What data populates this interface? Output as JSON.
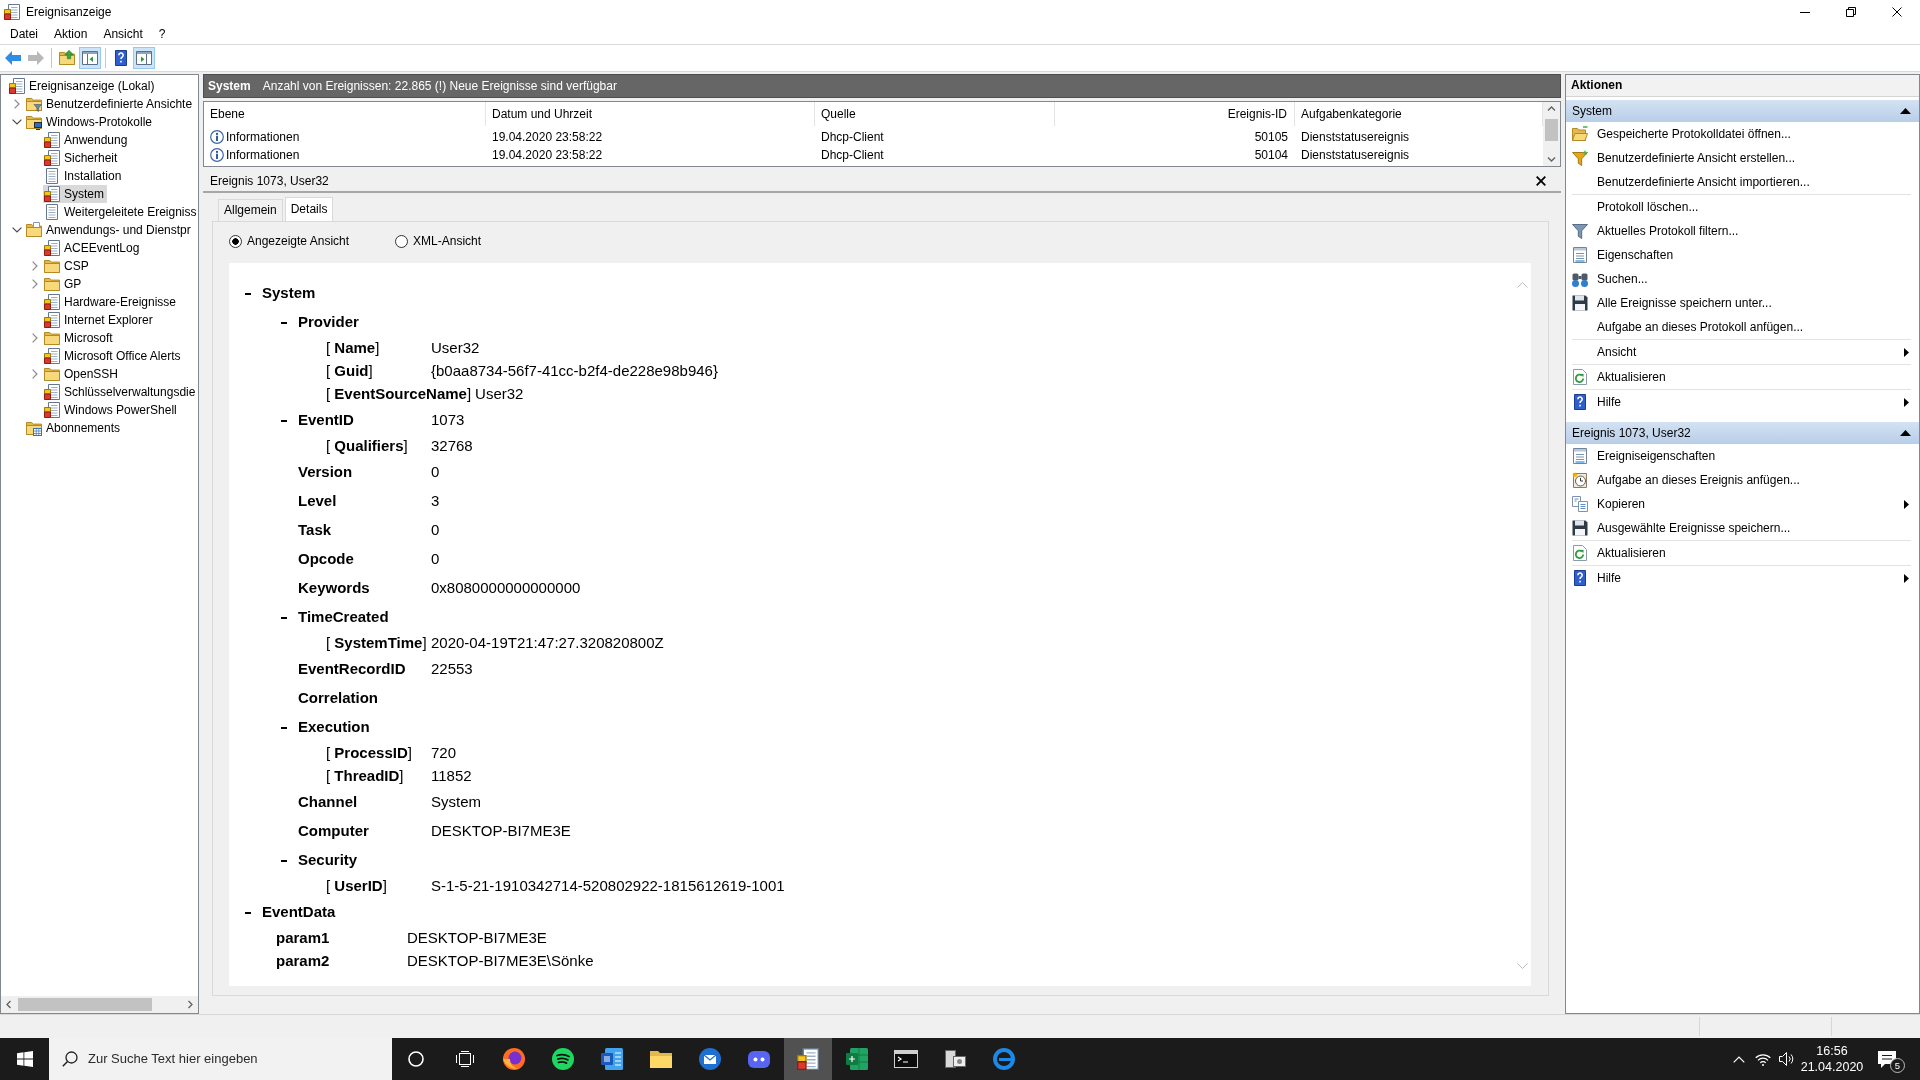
{
  "window": {
    "title": "Ereignisanzeige"
  },
  "menu": [
    "Datei",
    "Aktion",
    "Ansicht",
    "?"
  ],
  "toolbar": [
    [
      {
        "kind": "back",
        "pressed": false,
        "disabled": false
      },
      {
        "kind": "forward",
        "pressed": false,
        "disabled": true
      }
    ],
    [
      {
        "kind": "up",
        "pressed": false,
        "disabled": false
      },
      {
        "kind": "tree",
        "pressed": true,
        "disabled": false
      }
    ],
    [
      {
        "kind": "help",
        "pressed": false,
        "disabled": false
      },
      {
        "kind": "actions",
        "pressed": true,
        "disabled": false
      }
    ]
  ],
  "tree": [
    {
      "kind": "root",
      "label": "Ereignisanzeige (Lokal)",
      "selected": false,
      "children": [
        {
          "kind": "customviews",
          "label": "Benutzerdefinierte Ansichte",
          "selected": false,
          "expanded": false
        },
        {
          "kind": "windowslogs",
          "label": "Windows-Protokolle",
          "selected": false,
          "expanded": true,
          "children": [
            {
              "kind": "log",
              "label": "Anwendung",
              "selected": false
            },
            {
              "kind": "log",
              "label": "Sicherheit",
              "selected": false
            },
            {
              "kind": "plainlog",
              "label": "Installation",
              "selected": false
            },
            {
              "kind": "log",
              "label": "System",
              "selected": true
            },
            {
              "kind": "plainlog",
              "label": "Weitergeleitete Ereigniss",
              "selected": false
            }
          ]
        },
        {
          "kind": "appfolder",
          "label": "Anwendungs- und Dienstpr",
          "selected": false,
          "expanded": true,
          "children": [
            {
              "kind": "log",
              "label": "ACEEventLog",
              "selected": false
            },
            {
              "kind": "folder",
              "label": "CSP",
              "selected": false,
              "expanded": false
            },
            {
              "kind": "folder",
              "label": "GP",
              "selected": false,
              "expanded": false
            },
            {
              "kind": "log",
              "label": "Hardware-Ereignisse",
              "selected": false
            },
            {
              "kind": "log",
              "label": "Internet Explorer",
              "selected": false
            },
            {
              "kind": "folder",
              "label": "Microsoft",
              "selected": false,
              "expanded": false
            },
            {
              "kind": "log",
              "label": "Microsoft Office Alerts",
              "selected": false
            },
            {
              "kind": "folder",
              "label": "OpenSSH",
              "selected": false,
              "expanded": false
            },
            {
              "kind": "log",
              "label": "Schlüsselverwaltungsdie",
              "selected": false
            },
            {
              "kind": "log",
              "label": "Windows PowerShell",
              "selected": false
            }
          ]
        },
        {
          "kind": "subscriptions",
          "label": "Abonnements",
          "selected": false
        }
      ]
    }
  ],
  "log": {
    "title": "System",
    "summary": "Anzahl von Ereignissen: 22.865 (!) Neue Ereignisse sind verfügbar",
    "columns": [
      "Ebene",
      "Datum und Uhrzeit",
      "Quelle",
      "Ereignis-ID",
      "Aufgabenkategorie"
    ],
    "rows": [
      {
        "kind": "info",
        "selected": false,
        "cells": [
          "Informationen",
          "19.04.2020 23:58:22",
          "Dhcp-Client",
          "50105",
          "Dienststatusereignis"
        ]
      },
      {
        "kind": "info",
        "selected": false,
        "cells": [
          "Informationen",
          "19.04.2020 23:58:22",
          "Dhcp-Client",
          "50104",
          "Dienststatusereignis"
        ]
      }
    ]
  },
  "event": {
    "title": "Ereignis 1073, User32",
    "tabs": [
      {
        "label": "Allgemein",
        "selected": false
      },
      {
        "label": "Details",
        "selected": true
      }
    ],
    "views": [
      {
        "label": "Angezeigte Ansicht",
        "selected": true
      },
      {
        "label": "XML-Ansicht",
        "selected": false
      }
    ],
    "details": [
      {
        "kind": "section",
        "label": "System",
        "expanded": true,
        "children": [
          {
            "kind": "section",
            "label": "Provider",
            "expanded": true,
            "children": [
              {
                "kind": "attribute",
                "label": "[ **Name**]",
                "value": "User32"
              },
              {
                "kind": "attribute",
                "label": "[ **Guid**]",
                "value": "{b0aa8734-56f7-41cc-b2f4-de228e98b946}"
              },
              {
                "kind": "attribute",
                "label": "[ **EventSourceName**]",
                "value": "User32"
              }
            ]
          },
          {
            "kind": "section",
            "label": "EventID",
            "value": "1073",
            "expanded": true,
            "children": [
              {
                "kind": "attribute",
                "label": "[ **Qualifiers**]",
                "value": "32768"
              }
            ]
          },
          {
            "kind": "field",
            "label": "Version",
            "value": "0"
          },
          {
            "kind": "field",
            "label": "Level",
            "value": "3"
          },
          {
            "kind": "field",
            "label": "Task",
            "value": "0"
          },
          {
            "kind": "field",
            "label": "Opcode",
            "value": "0"
          },
          {
            "kind": "field",
            "label": "Keywords",
            "value": "0x8080000000000000"
          },
          {
            "kind": "section",
            "label": "TimeCreated",
            "expanded": true,
            "children": [
              {
                "kind": "attribute",
                "label": "[ **SystemTime**]",
                "value": "2020-04-19T21:47:27.320820800Z"
              }
            ]
          },
          {
            "kind": "field",
            "label": "EventRecordID",
            "value": "22553"
          },
          {
            "kind": "field",
            "label": "Correlation"
          },
          {
            "kind": "section",
            "label": "Execution",
            "expanded": true,
            "children": [
              {
                "kind": "attribute",
                "label": "[ **ProcessID**]",
                "value": "720"
              },
              {
                "kind": "attribute",
                "label": "[ **ThreadID**]",
                "value": "11852"
              }
            ]
          },
          {
            "kind": "field",
            "label": "Channel",
            "value": "System"
          },
          {
            "kind": "field",
            "label": "Computer",
            "value": "DESKTOP-BI7ME3E"
          },
          {
            "kind": "section",
            "label": "Security",
            "expanded": true,
            "children": [
              {
                "kind": "attribute",
                "label": "[ **UserID**]",
                "value": "S-1-5-21-1910342714-520802922-1815612619-1001"
              }
            ]
          }
        ]
      },
      {
        "kind": "section",
        "label": "EventData",
        "expanded": true,
        "children": [
          {
            "kind": "param",
            "label": "param1",
            "value": "DESKTOP-BI7ME3E"
          },
          {
            "kind": "param",
            "label": "param2",
            "value": "DESKTOP-BI7ME3E\\Sönke"
          }
        ]
      }
    ]
  },
  "actions": {
    "title": "Aktionen",
    "groups": [
      {
        "title": "System",
        "expanded": true,
        "blocks": [
          [
            {
              "kind": "open",
              "label": "Gespeicherte Protokolldatei öffnen...",
              "submenu": false
            },
            {
              "kind": "newview",
              "label": "Benutzerdefinierte Ansicht erstellen...",
              "submenu": false
            },
            {
              "kind": "plain",
              "label": "Benutzerdefinierte Ansicht importieren...",
              "submenu": false
            }
          ],
          [
            {
              "kind": "plain",
              "label": "Protokoll löschen...",
              "submenu": false
            },
            {
              "kind": "filter",
              "label": "Aktuelles Protokoll filtern...",
              "submenu": false
            },
            {
              "kind": "properties",
              "label": "Eigenschaften",
              "submenu": false
            },
            {
              "kind": "find",
              "label": "Suchen...",
              "submenu": false
            },
            {
              "kind": "save",
              "label": "Alle Ereignisse speichern unter...",
              "submenu": false
            },
            {
              "kind": "plain",
              "label": "Aufgabe an dieses Protokoll anfügen...",
              "submenu": false
            }
          ],
          [
            {
              "kind": "plain",
              "label": "Ansicht",
              "submenu": true
            }
          ],
          [
            {
              "kind": "refresh",
              "label": "Aktualisieren",
              "submenu": false
            }
          ],
          [
            {
              "kind": "help",
              "label": "Hilfe",
              "submenu": true
            }
          ]
        ]
      },
      {
        "title": "Ereignis 1073, User32",
        "expanded": true,
        "blocks": [
          [
            {
              "kind": "properties",
              "label": "Ereigniseigenschaften",
              "submenu": false
            },
            {
              "kind": "task",
              "label": "Aufgabe an dieses Ereignis anfügen...",
              "submenu": false
            },
            {
              "kind": "copy",
              "label": "Kopieren",
              "submenu": true
            },
            {
              "kind": "save",
              "label": "Ausgewählte Ereignisse speichern...",
              "submenu": false
            }
          ],
          [
            {
              "kind": "refresh",
              "label": "Aktualisieren",
              "submenu": false
            }
          ],
          [
            {
              "kind": "help",
              "label": "Hilfe",
              "submenu": true
            }
          ]
        ]
      }
    ]
  },
  "taskbar": {
    "search": {
      "placeholder": "Zur Suche Text hier eingeben"
    },
    "apps": [
      {
        "kind": "browser",
        "selected": false
      },
      {
        "kind": "music",
        "selected": false
      },
      {
        "kind": "writer",
        "selected": false
      },
      {
        "kind": "files",
        "selected": false
      },
      {
        "kind": "mail",
        "selected": false
      },
      {
        "kind": "chat",
        "selected": false
      },
      {
        "kind": "events",
        "selected": true
      },
      {
        "kind": "sheets",
        "selected": false
      },
      {
        "kind": "terminal",
        "selected": false
      },
      {
        "kind": "device",
        "selected": false
      },
      {
        "kind": "web",
        "selected": false
      }
    ],
    "time": "16:56",
    "date": "21.04.2020",
    "notifications": "5"
  }
}
